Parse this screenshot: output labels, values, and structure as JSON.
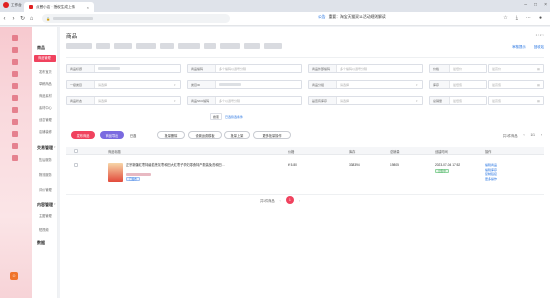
{
  "browser": {
    "app_name": "工作台",
    "tab_title": "点餐小店 · 授权生成上传",
    "notice_tag": "公告",
    "notice_text": "重要：淘宝天猫双11活动规则解读"
  },
  "nav": {
    "section_goods": "商品",
    "items_goods": [
      "商品管理",
      "发布宝贝",
      "草稿商品",
      "商品素材",
      "素材中心",
      "创意管理",
      "店铺装修"
    ],
    "section_trade": "交易管理",
    "items_trade": [
      "售后服务",
      "物流服务",
      "评价管理"
    ],
    "section_content": "内容管理",
    "items_content": [
      "主图管理",
      "短视频"
    ],
    "section_data": "数据"
  },
  "main": {
    "page_title": "商品",
    "top_hint": "1 / 2 >",
    "top_links": [
      "审核提示",
      "回收站"
    ],
    "filters": [
      {
        "label": "商品标题",
        "value": ""
      },
      {
        "label": "商品编码",
        "value": "多个编码以逗号分隔"
      },
      {
        "label": "商品外部编码",
        "value": "多个编码以逗号分隔"
      },
      {
        "label": "价格",
        "value": "最低价"
      },
      {
        "label": "价格",
        "value": "最高价"
      },
      {
        "label": "一级类目",
        "value": "请选择"
      },
      {
        "label": "类目ID",
        "value": ""
      },
      {
        "label": "商品分组",
        "value": "请选择"
      },
      {
        "label": "库存",
        "value": "最低值"
      },
      {
        "label": "库存",
        "value": "最高值"
      },
      {
        "label": "商品状态",
        "value": "请选择"
      },
      {
        "label": "商品SKU编码",
        "value": "多个以逗号分隔"
      },
      {
        "label": "是否有库存",
        "value": "请选择"
      },
      {
        "label": "总销量",
        "value": "最低值"
      },
      {
        "label": "总销量",
        "value": "最高值"
      }
    ],
    "search_label": "搜索",
    "advanced_label": "已选筛选条件",
    "action_buttons": [
      "发布商品",
      "商品导出",
      "已选",
      "批量删除",
      "设置运费模板",
      "批量上架",
      "更多批量操作"
    ],
    "result_count": "共1件商品",
    "page_size": "1/1",
    "columns": [
      "商品标题",
      "价格",
      "库存",
      "总销量",
      "创建时间",
      "操作"
    ],
    "rows": [
      {
        "title": "正宗新疆红枣特级若羌灰枣和田大红枣子孕妇零食特产散装免洗和田…",
        "tag": "已发布",
        "price": "¥ 5.80",
        "stock": "338394",
        "sales": "19805",
        "created": "2023-07-04 17:52",
        "status": "出售中",
        "ops": [
          "编辑商品",
          "编辑库存",
          "复制链接",
          "更多操作"
        ]
      }
    ],
    "pager": {
      "total": "共1件商品",
      "current": "1"
    }
  }
}
